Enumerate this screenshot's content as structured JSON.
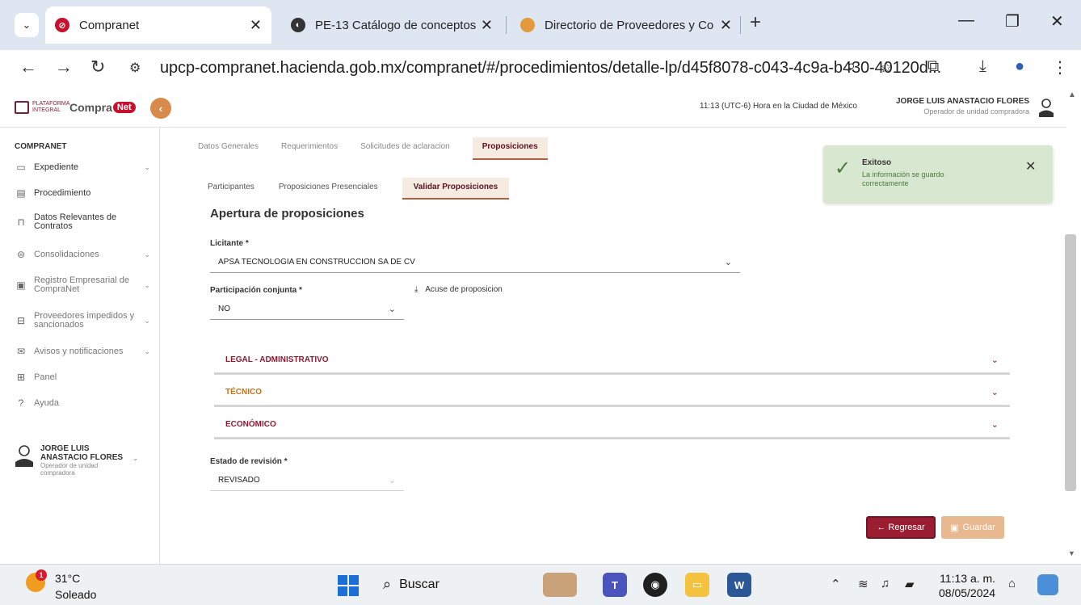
{
  "browser": {
    "tabs": [
      {
        "title": "Compranet",
        "close": "✕",
        "active": true
      },
      {
        "title": "PE-13 Catálogo de conceptos,",
        "close": "✕"
      },
      {
        "title": "Directorio de Proveedores y Co",
        "close": "✕"
      }
    ],
    "new_tab": "+",
    "url": "upcp-compranet.hacienda.gob.mx/compranet/#/procedimientos/detalle-lp/d45f8078-c043-4c9a-b430-40120d...",
    "window": {
      "minimize": "—",
      "maximize": "❐",
      "close": "✕"
    }
  },
  "header": {
    "logo_small": "PLATAFORMA INTEGRAL",
    "logo_brand": "Compra",
    "logo_net": "Net",
    "time": "11:13 (UTC-6) Hora en la Ciudad de México",
    "user_name": "JORGE LUIS ANASTACIO FLORES",
    "user_role": "Operador de unidad compradora"
  },
  "sidebar": {
    "section": "COMPRANET",
    "items": [
      {
        "label": "Expediente",
        "icon": "folder-open-icon",
        "chev": "⌄"
      },
      {
        "label": "Procedimiento",
        "icon": "document-icon",
        "chev": ""
      },
      {
        "label": "Datos Relevantes de Contratos",
        "icon": "bookmark-icon",
        "chev": ""
      },
      {
        "label": "Consolidaciones",
        "icon": "stack-icon",
        "chev": "⌄"
      },
      {
        "label": "Registro Empresarial de CompraNet",
        "icon": "id-card-icon",
        "chev": "⌄"
      },
      {
        "label": "Proveedores impedidos y sancionados",
        "icon": "warning-box-icon",
        "chev": "⌄"
      },
      {
        "label": "Avisos y notificaciones",
        "icon": "mail-icon",
        "chev": "⌄"
      },
      {
        "label": "Panel",
        "icon": "grid-icon",
        "chev": ""
      },
      {
        "label": "Ayuda",
        "icon": "question-icon",
        "chev": ""
      }
    ],
    "user_name": "JORGE LUIS ANASTACIO FLORES",
    "user_role": "Operador de unidad compradora"
  },
  "main": {
    "tabs": [
      "Datos Generales",
      "Requerimientos",
      "Solicitudes de aclaracion",
      "Proposiciones"
    ],
    "active_tab": "Proposiciones",
    "subtabs": [
      "Participantes",
      "Proposiciones Presenciales",
      "Validar Proposiciones"
    ],
    "active_subtab": "Validar Proposiciones",
    "title": "Apertura de proposiciones",
    "licitante_label": "Licitante *",
    "licitante_value": "APSA TECNOLOGIA EN CONSTRUCCION SA DE CV",
    "conjunta_label": "Participación conjunta *",
    "conjunta_value": "NO",
    "acuse": "Acuse de proposicion",
    "sections": [
      {
        "label": "LEGAL - ADMINISTRATIVO",
        "color": "#8a1c32"
      },
      {
        "label": "TÉCNICO",
        "color": "#c8711c"
      },
      {
        "label": "ECONÓMICO",
        "color": "#8a1c32"
      }
    ],
    "estado_label": "Estado de revisión *",
    "estado_value": "REVISADO",
    "back_button": "← Regresar",
    "save_button": "Guardar"
  },
  "toast": {
    "title": "Exitoso",
    "message": "La información se guardo correctamente",
    "close": "✕"
  },
  "taskbar": {
    "temp": "31°C",
    "weather": "Soleado",
    "badge": "1",
    "search": "Buscar",
    "time": "11:13 a. m.",
    "date": "08/05/2024"
  },
  "colors": {
    "brand": "#9b1d32",
    "accent": "#d9894a",
    "success_bg": "#d8e8d0"
  }
}
